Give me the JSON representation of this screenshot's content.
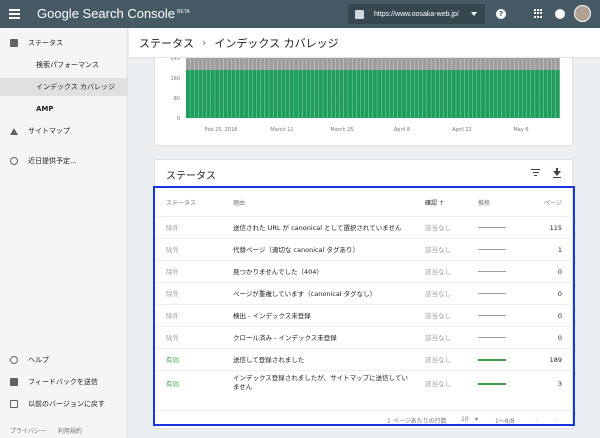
{
  "app": {
    "brand_prefix": "Google Search Console",
    "brand_badge": "BETA",
    "property_url": "https://www.oosaka-web.jp/"
  },
  "sidebar": {
    "items": [
      {
        "label": "ステータス",
        "icon": "dashboard-icon"
      },
      {
        "label": "検索パフォーマンス"
      },
      {
        "label": "インデックス カバレッジ"
      },
      {
        "label": "AMP"
      },
      {
        "label": "サイトマップ",
        "icon": "upload-icon"
      },
      {
        "label": "近日提供予定...",
        "icon": "info-icon"
      },
      {
        "label": "ヘルプ",
        "icon": "help-icon"
      },
      {
        "label": "フィードバックを送信",
        "icon": "feedback-icon"
      },
      {
        "label": "以前のバージョンに戻す",
        "icon": "exit-icon"
      }
    ],
    "footer": [
      "プライバシー",
      "利用規約"
    ]
  },
  "breadcrumb": {
    "root": "ステータス",
    "separator": "›",
    "current": "インデックス カバレッジ"
  },
  "chart_data": {
    "type": "bar",
    "ylim": [
      0,
      240
    ],
    "yticks": [
      "240",
      "160",
      "80",
      "0"
    ],
    "xticks": [
      "Feb 25, 2018",
      "March 11",
      "March 25",
      "April 8",
      "April 22",
      "May 6"
    ],
    "series": [
      {
        "color": "#1e9e5a",
        "values": [
          192,
          192,
          192,
          192,
          192,
          192,
          192,
          192,
          192,
          192,
          192,
          192,
          192,
          192,
          192,
          192,
          192,
          192,
          192,
          192,
          192,
          192,
          192,
          192,
          192,
          192,
          192,
          192,
          192,
          192,
          192,
          192,
          192,
          192,
          192,
          192,
          192,
          192,
          192,
          192,
          192,
          192,
          192,
          192,
          192,
          192,
          192,
          192,
          192,
          192,
          192,
          192,
          192,
          192,
          192,
          192,
          192,
          192,
          192,
          192,
          192,
          192,
          192,
          192,
          192,
          192,
          192,
          192,
          192,
          192,
          192,
          192,
          192,
          192,
          192,
          192,
          192,
          192,
          192,
          192,
          192,
          192,
          192,
          192,
          192,
          192,
          192,
          192,
          192,
          192
        ]
      },
      {
        "color": "#9e9e9e",
        "values": [
          54,
          54,
          54,
          54,
          54,
          54,
          54,
          54,
          54,
          54,
          54,
          54,
          54,
          54,
          54,
          54,
          54,
          54,
          54,
          54,
          54,
          54,
          54,
          54,
          54,
          54,
          54,
          54,
          54,
          54,
          54,
          54,
          54,
          54,
          54,
          54,
          54,
          54,
          54,
          54,
          54,
          54,
          54,
          54,
          54,
          54,
          54,
          54,
          54,
          54,
          54,
          54,
          54,
          54,
          54,
          54,
          54,
          54,
          54,
          54,
          54,
          54,
          54,
          54,
          54,
          54,
          54,
          54,
          54,
          54,
          54,
          54,
          54,
          54,
          54,
          54,
          54,
          54,
          54,
          54,
          54,
          54,
          54,
          54,
          54,
          54,
          54,
          54,
          54,
          54
        ]
      }
    ]
  },
  "status_card": {
    "title": "ステータス",
    "columns": {
      "status": "ステータス",
      "reason": "理由",
      "confirmation": "確認",
      "trend": "推移",
      "pages": "ページ"
    },
    "rows": [
      {
        "status": "除外",
        "reason": "送信された URL が canonical として選択されていません",
        "confirmation": "該当なし",
        "pages": "115",
        "ok": false
      },
      {
        "status": "除外",
        "reason": "代替ページ（適切な canonical タグあり）",
        "confirmation": "該当なし",
        "pages": "1",
        "ok": false
      },
      {
        "status": "除外",
        "reason": "見つかりませんでした（404）",
        "confirmation": "該当なし",
        "pages": "0",
        "ok": false
      },
      {
        "status": "除外",
        "reason": "ページが重複しています（canonical タグなし）",
        "confirmation": "該当なし",
        "pages": "0",
        "ok": false
      },
      {
        "status": "除外",
        "reason": "検出 - インデックス未登録",
        "confirmation": "該当なし",
        "pages": "0",
        "ok": false
      },
      {
        "status": "除外",
        "reason": "クロール済み - インデックス未登録",
        "confirmation": "該当なし",
        "pages": "0",
        "ok": false
      },
      {
        "status": "有効",
        "reason": "送信して登録されました",
        "confirmation": "該当なし",
        "pages": "189",
        "ok": true
      },
      {
        "status": "有効",
        "reason": "インデックス登録されましたが、サイトマップに送信していません",
        "confirmation": "該当なし",
        "pages": "3",
        "ok": true
      }
    ],
    "pager": {
      "rows_per_page_label": "1 ページあたりの行数",
      "rows_per_page_value": "10",
      "range": "1〜8/8"
    }
  },
  "colors": {
    "topbar": "#455a64",
    "valid": "#43a047",
    "highlight": "#1a33e0"
  }
}
